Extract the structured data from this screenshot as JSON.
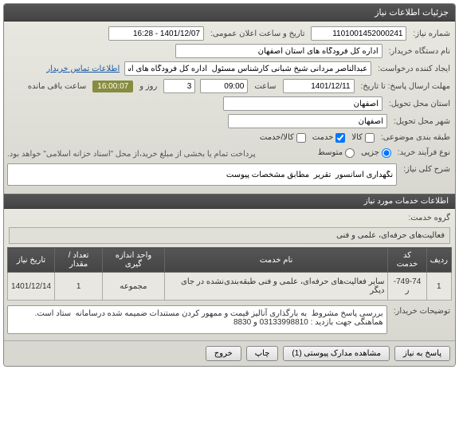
{
  "panel": {
    "title": "جزئیات اطلاعات نیاز"
  },
  "needNumber": {
    "label": "شماره نیاز:",
    "value": "1101001452000241"
  },
  "announceDate": {
    "label": "تاریخ و ساعت اعلان عمومی:",
    "value": "1401/12/07 - 16:28"
  },
  "buyerName": {
    "label": "نام دستگاه خریدار:",
    "value": "اداره کل فرودگاه های استان اصفهان"
  },
  "requestor": {
    "label": "ایجاد کننده درخواست:",
    "value": "عبدالناصر مردانی شیخ شبانی کارشناس مسئول  اداره کل فرودگاه های استان"
  },
  "contactLink": "اطلاعات تماس خریدار",
  "deadline": {
    "label": "مهلت ارسال پاسخ: تا تاریخ:",
    "date": "1401/12/11",
    "timeLabel": "ساعت",
    "time": "09:00",
    "daysValue": "3",
    "daysLabel": "روز و",
    "countdown": "16:00:07",
    "remainLabel": "ساعت باقی مانده"
  },
  "deliveryProvince": {
    "label": "استان محل تحویل:",
    "value": "اصفهان"
  },
  "deliveryCity": {
    "label": "شهر محل تحویل:",
    "value": "اصفهان"
  },
  "subjectClass": {
    "label": "طبقه بندی موضوعی:",
    "opts": {
      "kala": "کالا",
      "khadamat": "خدمت",
      "kalakhadamat": "کالا/خدمت"
    }
  },
  "purchaseType": {
    "label": "نوع فرآیند خرید:",
    "opts": {
      "jozei": "جزیی",
      "motavaset": "متوسط"
    }
  },
  "paymentNote": "پرداخت تمام یا بخشی از مبلغ خرید،از محل \"اسناد خزانه اسلامی\" خواهد بود.",
  "generalDesc": {
    "label": "شرح کلی نیاز:",
    "value": "نگهداری آسانسور  تقریر  مطابق مشخصات پیوست"
  },
  "servicesInfo": {
    "header": "اطلاعات خدمات مورد نیاز"
  },
  "serviceGroups": {
    "label": "گروه خدمت:",
    "value": "فعالیت‌های حرفه‌ای، علمی و فنی"
  },
  "tableHeaders": {
    "row": "ردیف",
    "code": "کد خدمت",
    "name": "نام خدمت",
    "unit": "واحد اندازه گیری",
    "qty": "تعداد / مقدار",
    "date": "تاریخ نیاز"
  },
  "tableRow": {
    "row": "1",
    "code": "749-74-ر",
    "name": "سایر فعالیت‌های حرفه‌ای، علمی و فنی طبقه‌بندی‌نشده در جای دیگر",
    "unit": "مجموعه",
    "qty": "1",
    "date": "1401/12/14"
  },
  "buyerNotes": {
    "label": "توضیحات خریدار:",
    "value": "بررسی پاسخ مشروط  به بارگذاری آنالیز قیمت و ممهور کردن مستندات ضمیمه شده درسامانه  ستاد است.\nهماهنگی جهت بازدید : 03133998810 و 8830"
  },
  "buttons": {
    "reply": "پاسخ به نیاز",
    "attachments": "مشاهده مدارک پیوستی (1)",
    "print": "چاپ",
    "close": "خروج"
  }
}
